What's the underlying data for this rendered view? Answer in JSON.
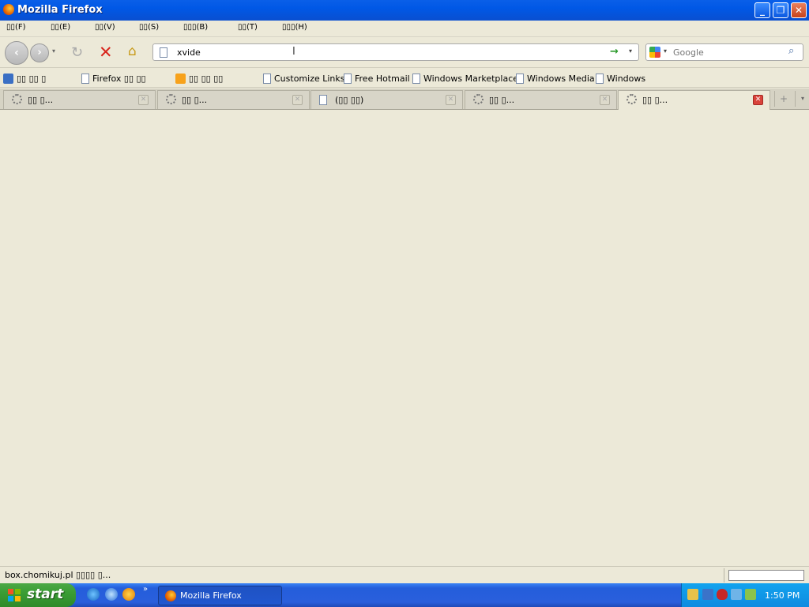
{
  "window": {
    "title": "Mozilla Firefox"
  },
  "menu": [
    {
      "label": "▯▯(F)"
    },
    {
      "label": "▯▯(E)"
    },
    {
      "label": "▯▯(V)"
    },
    {
      "label": "▯▯(S)"
    },
    {
      "label": "▯▯▯(B)"
    },
    {
      "label": "▯▯(T)"
    },
    {
      "label": "▯▯▯(H)"
    }
  ],
  "navbar": {
    "url_value": "xvide",
    "search_placeholder": "Google"
  },
  "bookmarks": [
    {
      "label": "▯▯ ▯▯ ▯",
      "icon": "search-icon"
    },
    {
      "label": "Firefox ▯▯ ▯▯",
      "icon": "page-icon"
    },
    {
      "label": "▯▯ ▯▯ ▯▯",
      "icon": "feed-icon"
    },
    {
      "label": "Customize Links",
      "icon": "page-icon"
    },
    {
      "label": "Free Hotmail",
      "icon": "page-icon"
    },
    {
      "label": "Windows Marketplace",
      "icon": "page-icon"
    },
    {
      "label": "Windows Media",
      "icon": "page-icon"
    },
    {
      "label": "Windows",
      "icon": "page-icon"
    }
  ],
  "tabs": [
    {
      "label": "▯▯ ▯...",
      "loading": true
    },
    {
      "label": "▯▯ ▯...",
      "loading": true
    },
    {
      "label": "(▯▯ ▯▯)",
      "loading": false
    },
    {
      "label": "▯▯ ▯...",
      "loading": true
    },
    {
      "label": "▯▯ ▯...",
      "loading": true,
      "active": true
    }
  ],
  "status": {
    "text": "box.chomikuj.pl ▯▯▯▯ ▯..."
  },
  "taskbar": {
    "start_label": "start",
    "window_button_label": "Mozilla Firefox",
    "clock": "1:50 PM"
  },
  "colors": {
    "titlebar": "#0058e6",
    "stop": "#d8241b",
    "taskbar": "#245edb",
    "start": "#3a9d34"
  }
}
